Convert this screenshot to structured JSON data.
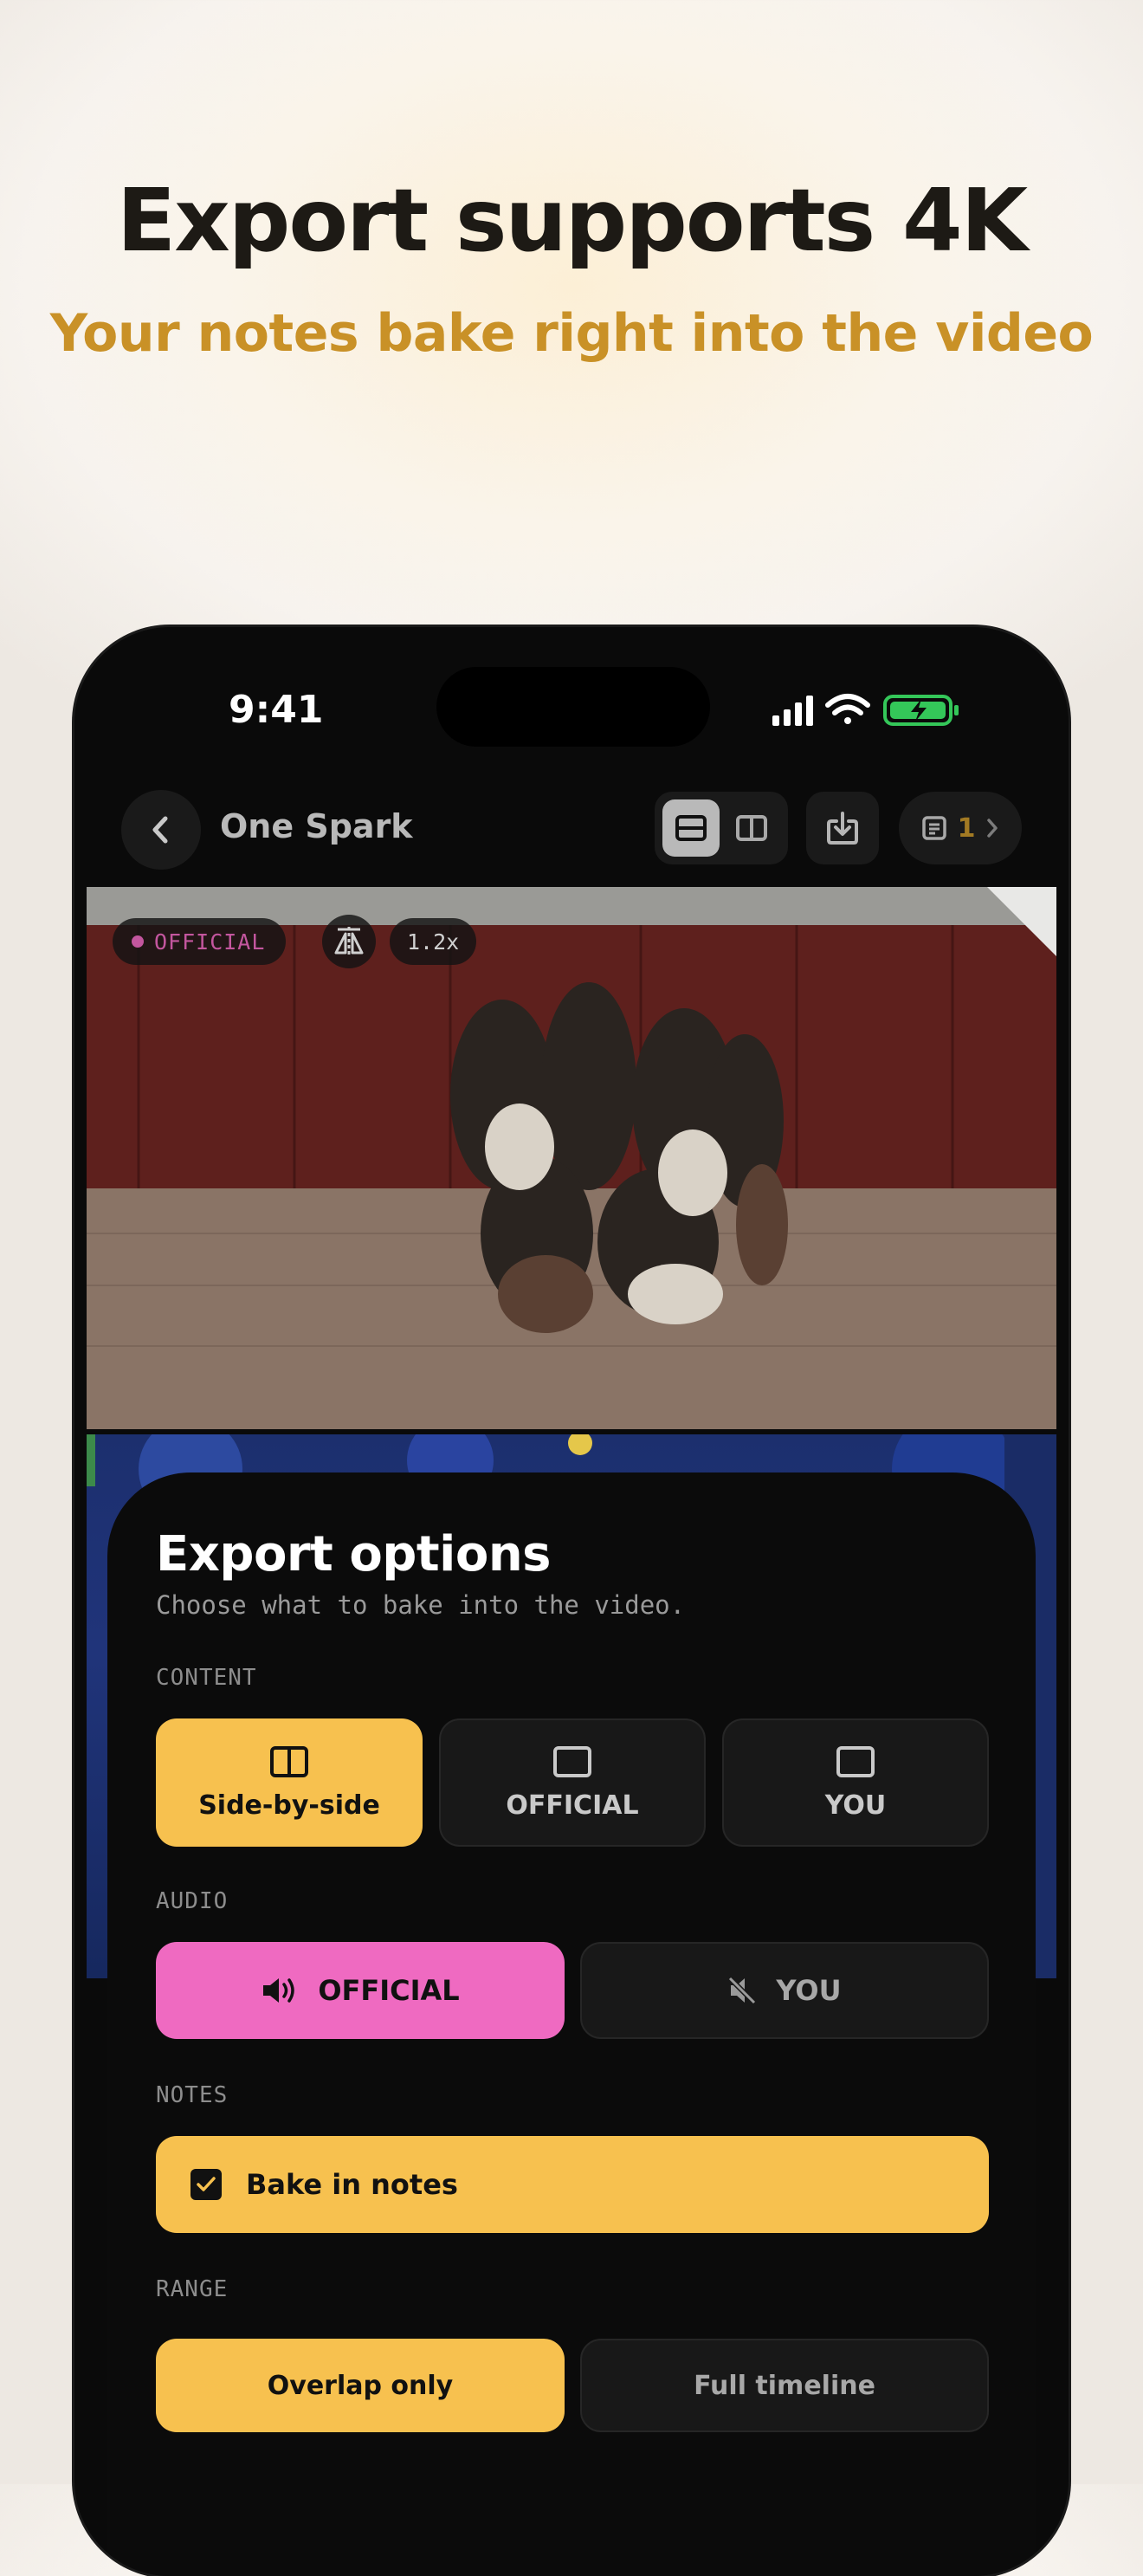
{
  "hero": {
    "headline": "Export supports 4K",
    "subline": "Your notes bake right into the video"
  },
  "status_bar": {
    "time": "9:41",
    "icons": [
      "signal-icon",
      "wifi-icon",
      "battery-charging-icon"
    ]
  },
  "nav": {
    "title": "One Spark",
    "notes_count": "1",
    "icons": [
      "chevron-left-icon",
      "layout-stacked-icon",
      "layout-side-by-side-icon",
      "download-icon",
      "notes-icon",
      "chevron-right-icon"
    ]
  },
  "video_overlay": {
    "source_label": "OFFICIAL",
    "speed": "1.2x"
  },
  "export_sheet": {
    "title": "Export options",
    "subtitle": "Choose what to bake into the video.",
    "content": {
      "label": "CONTENT",
      "options": [
        "Side-by-side",
        "OFFICIAL",
        "YOU"
      ],
      "selected": "Side-by-side"
    },
    "audio": {
      "label": "AUDIO",
      "options": [
        "OFFICIAL",
        "YOU"
      ],
      "selected": "OFFICIAL"
    },
    "notes": {
      "label": "NOTES",
      "checkbox_label": "Bake in notes",
      "checked": true
    },
    "range": {
      "label": "RANGE",
      "options": [
        "Overlap only",
        "Full timeline"
      ],
      "selected": "Overlap only"
    }
  },
  "colors": {
    "accent_yellow": "#f7c14f",
    "accent_pink": "#ef6ac1",
    "subline_gold": "#c99127",
    "sheet_bg": "#0b0b0b"
  }
}
